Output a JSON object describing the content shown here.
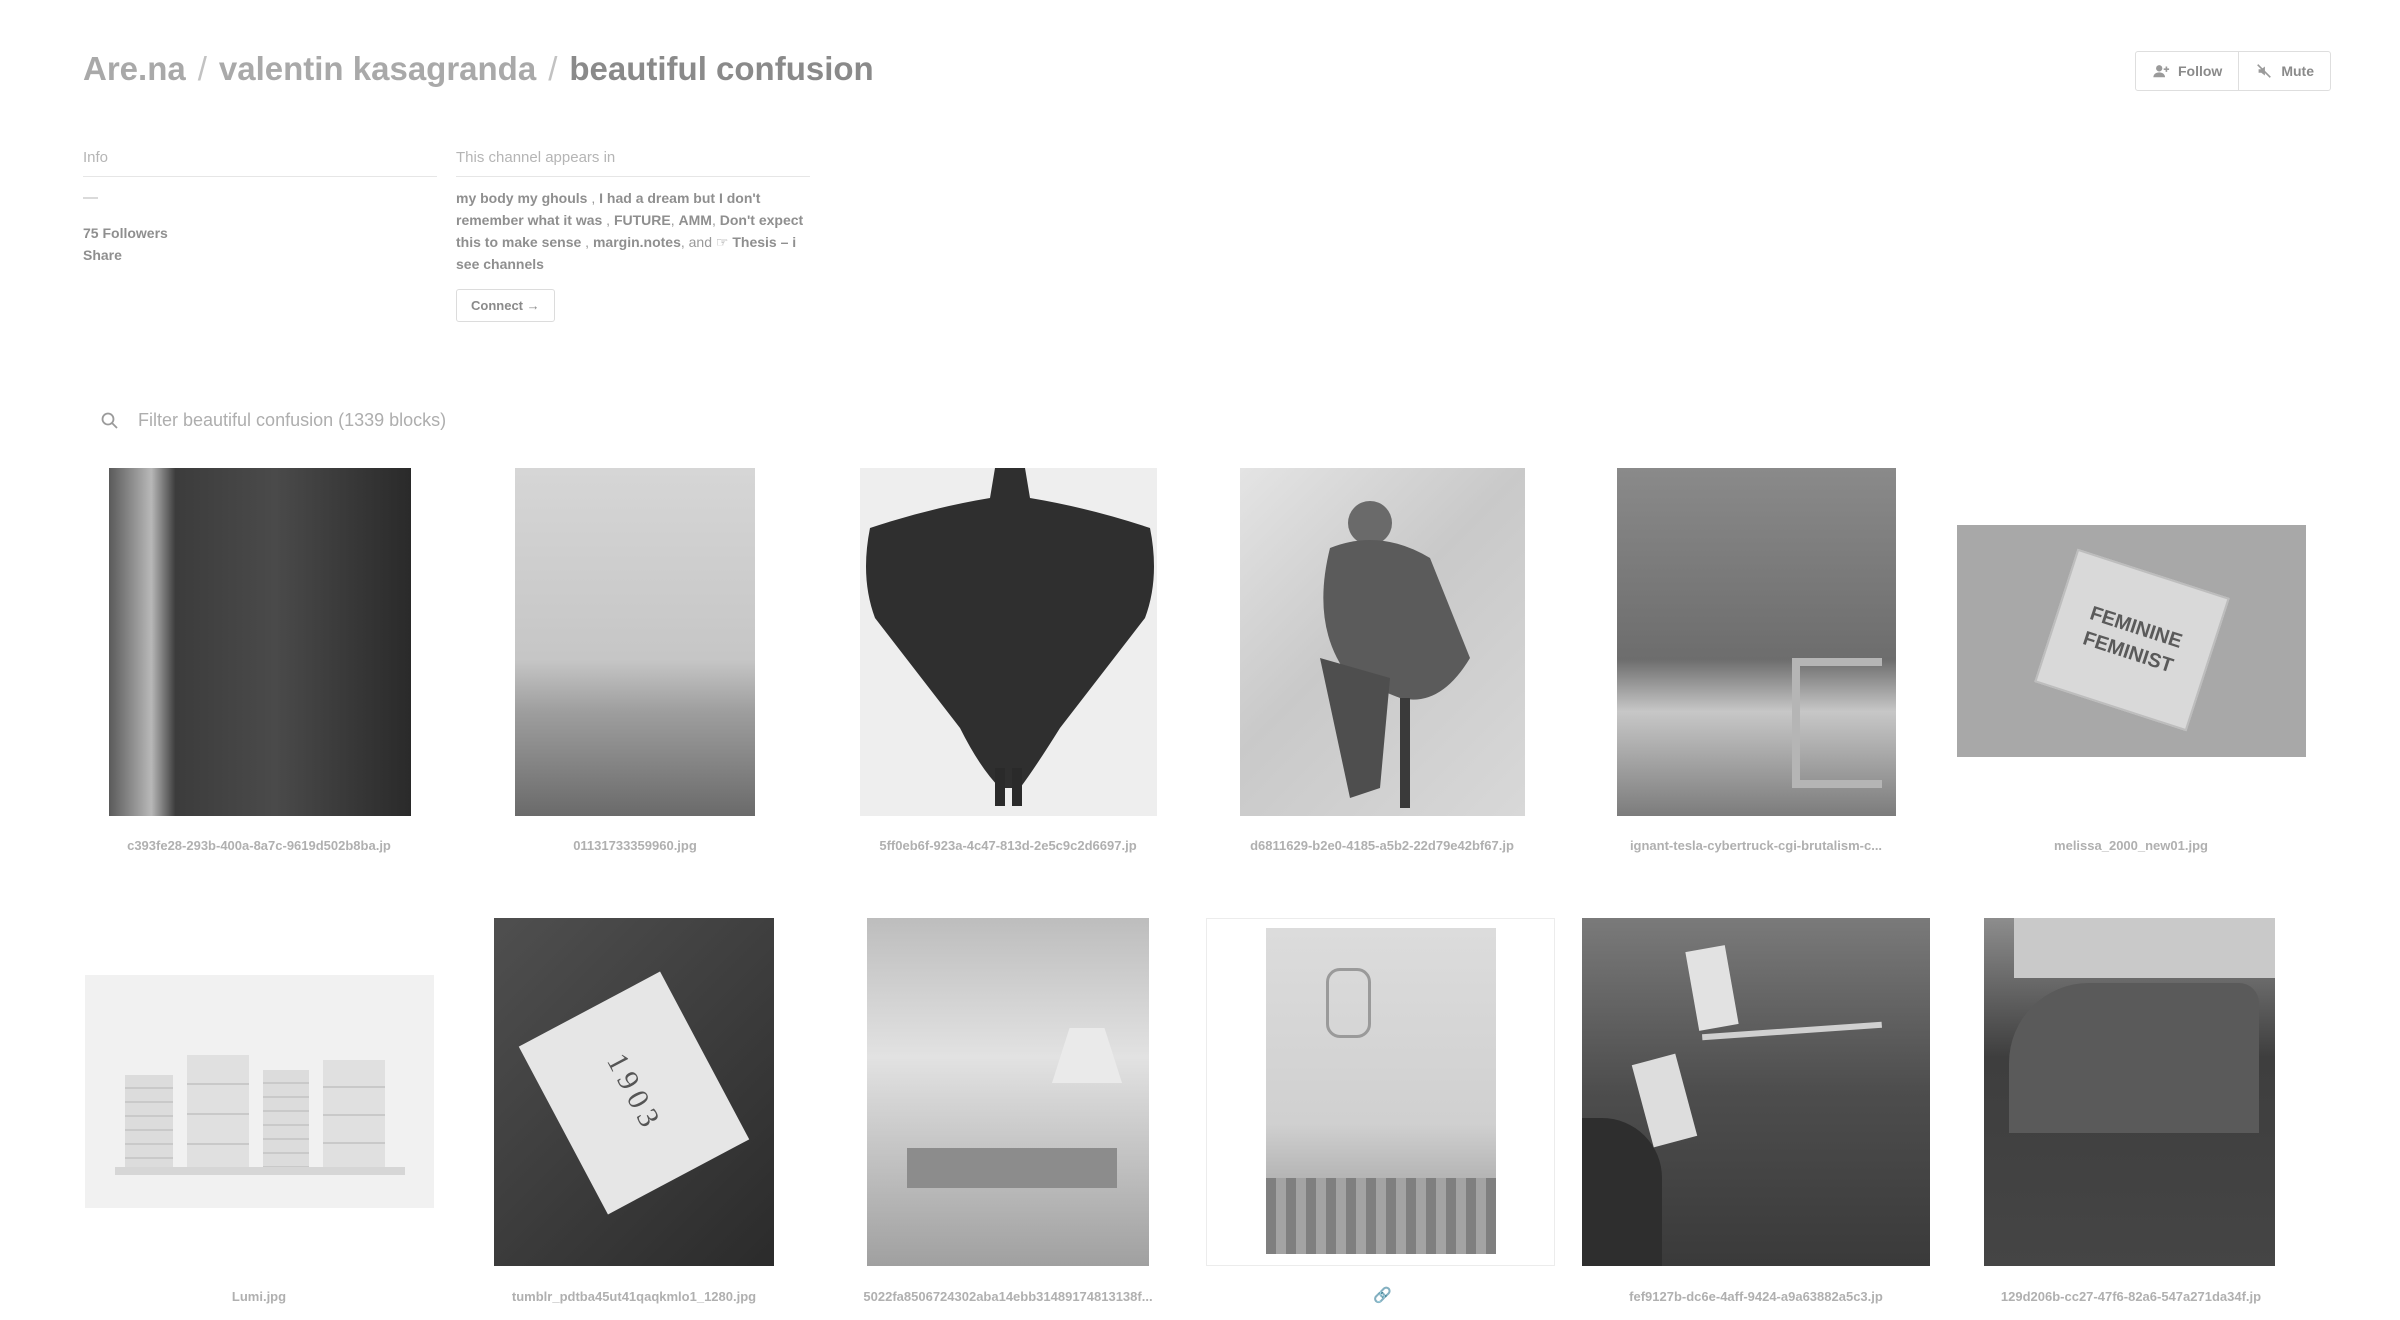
{
  "breadcrumb": {
    "site": "Are.na",
    "user": "valentin kasagranda",
    "channel": "beautiful confusion"
  },
  "actions": {
    "follow_label": "Follow",
    "mute_label": "Mute"
  },
  "info": {
    "title": "Info",
    "description": "—",
    "followers": "75 Followers",
    "share": "Share"
  },
  "appears_in": {
    "title": "This channel appears in",
    "channels": [
      "my body my ghouls",
      "I had a dream but I don't remember what it was",
      "FUTURE",
      "AMM",
      "Don't expect this to make sense",
      "margin.notes",
      "Thesis – i see channels"
    ],
    "and_text": "and",
    "connect_label": "Connect →"
  },
  "filter": {
    "placeholder": "Filter beautiful confusion (1339 blocks)"
  },
  "blocks": [
    {
      "caption": "c393fe28-293b-400a-8a7c-9619d502b8ba.jp"
    },
    {
      "caption": "01131733359960.jpg"
    },
    {
      "caption": "5ff0eb6f-923a-4c47-813d-2e5c9c2d6697.jp"
    },
    {
      "caption": "d6811629-b2e0-4185-a5b2-22d79e42bf67.jp"
    },
    {
      "caption": "ignant-tesla-cybertruck-cgi-brutalism-c..."
    },
    {
      "caption": "melissa_2000_new01.jpg"
    },
    {
      "caption": "Lumi.jpg"
    },
    {
      "caption": "tumblr_pdtba45ut41qaqkmlo1_1280.jpg"
    },
    {
      "caption": "5022fa8506724302aba14ebb31489174813138f..."
    },
    {
      "caption": ""
    },
    {
      "caption": "fef9127b-dc6e-4aff-9424-a9a63882a5c3.jp"
    },
    {
      "caption": "129d206b-cc27-47f6-82a6-547a271da34f.jp"
    }
  ],
  "image_texts": {
    "magazine": "FEMININE FEMINIST",
    "box_number": "1903"
  }
}
